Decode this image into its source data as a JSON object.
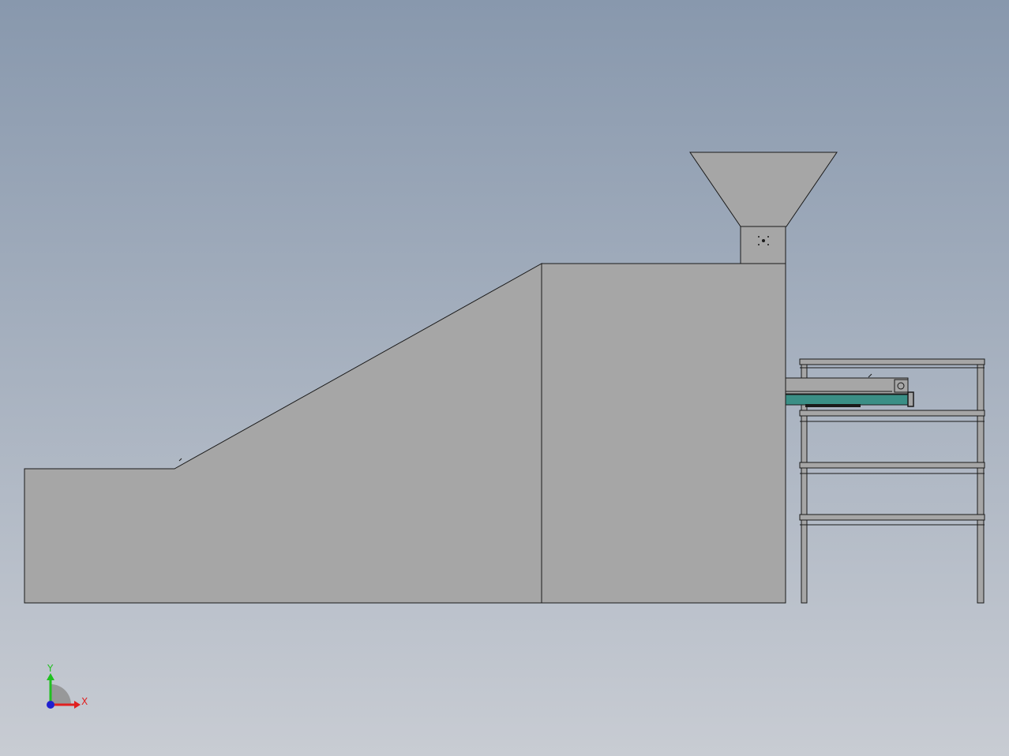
{
  "viewport": {
    "background_top": "#8898ad",
    "background_bottom": "#c8ccd3"
  },
  "model": {
    "body_fill": "#a6a6a6",
    "edge_color": "#1a1a1a",
    "accent_teal": "#3a8f86"
  },
  "triad": {
    "x_label": "X",
    "y_label": "Y",
    "x_color": "#e02020",
    "y_color": "#20c020",
    "z_color": "#2020d0"
  }
}
